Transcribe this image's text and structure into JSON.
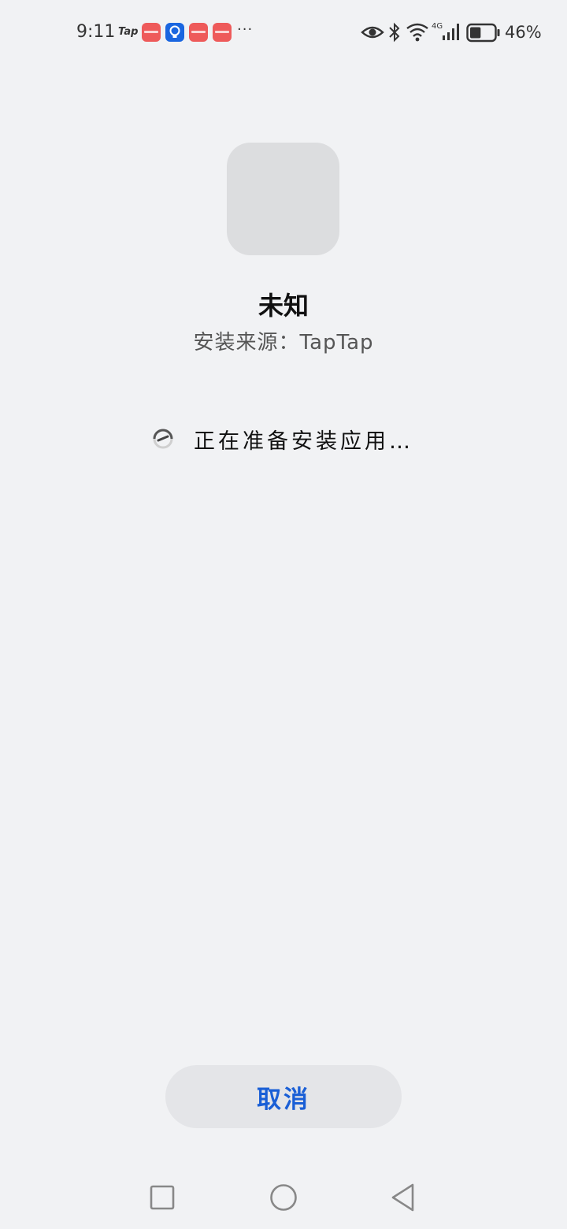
{
  "status_bar": {
    "time": "9:11",
    "tap_label": "Tap",
    "more": "···",
    "battery_percent": "46%",
    "network": "4G",
    "notification_icons": [
      "taptap-icon",
      "huawei-appgallery-icon",
      "bulb-app-icon",
      "huawei-appgallery-icon",
      "huawei-appgallery-icon"
    ],
    "battery_level": 0.46
  },
  "installer": {
    "app_name": "未知",
    "source_label": "安装来源：TapTap",
    "progress_text": "正在准备安装应用…",
    "cancel_label": "取消"
  },
  "nav_bar": {
    "items": [
      "recents-square-icon",
      "home-circle-icon",
      "back-triangle-icon"
    ]
  },
  "colors": {
    "background": "#f1f2f4",
    "accent": "#1a5fd6",
    "icon_placeholder": "#dcdddf",
    "button_bg": "#e4e5e8"
  }
}
